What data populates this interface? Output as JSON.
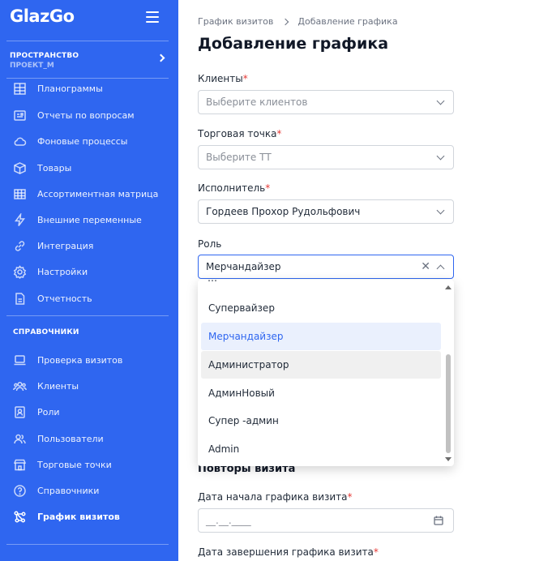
{
  "sidebar": {
    "logo": "GlazGo",
    "workspace": {
      "title": "ПРОСТРАНСТВО",
      "subtitle": "ПРОЕКТ_М"
    },
    "items": [
      {
        "label": "Планограммы",
        "icon": "planogram-icon"
      },
      {
        "label": "Отчеты по вопросам",
        "icon": "report-icon"
      },
      {
        "label": "Фоновые процессы",
        "icon": "cloud-icon"
      },
      {
        "label": "Товары",
        "icon": "box-icon"
      },
      {
        "label": "Ассортиментная матрица",
        "icon": "table-icon"
      },
      {
        "label": "Внешние переменные",
        "icon": "lightning-icon"
      },
      {
        "label": "Интеграция",
        "icon": "link-icon"
      },
      {
        "label": "Настройки",
        "icon": "gear-icon"
      },
      {
        "label": "Отчетность",
        "icon": "document-icon"
      }
    ],
    "section_title": "СПРАВОЧНИКИ",
    "ref_items": [
      {
        "label": "Проверка визитов",
        "icon": "laptop-icon"
      },
      {
        "label": "Клиенты",
        "icon": "users-icon"
      },
      {
        "label": "Роли",
        "icon": "id-card-icon"
      },
      {
        "label": "Пользователи",
        "icon": "user-group-icon"
      },
      {
        "label": "Торговые точки",
        "icon": "store-icon"
      },
      {
        "label": "Справочники",
        "icon": "book-icon"
      },
      {
        "label": "График визитов",
        "icon": "graph-icon",
        "active": true
      }
    ]
  },
  "breadcrumb": {
    "parent": "График визитов",
    "current": "Добавление графика"
  },
  "page_title": "Добавление графика",
  "form": {
    "clients": {
      "label": "Клиенты",
      "required": "*",
      "placeholder": "Выберите клиентов"
    },
    "outlet": {
      "label": "Торговая точка",
      "required": "*",
      "placeholder": "Выберите ТТ"
    },
    "executor": {
      "label": "Исполнитель",
      "required": "*",
      "value": "Гордеев Прохор Рудольфович"
    },
    "role": {
      "label": "Роль",
      "value": "Мерчандайзер",
      "options": [
        "Супервайзер",
        "Мерчандайзер",
        "Администратор",
        "АдминНовый",
        "Супер -админ",
        "Admin"
      ],
      "selected": "Мерчандайзер",
      "hovered": "Администратор"
    },
    "repeats_title": "Повторы визита",
    "start_date": {
      "label": "Дата начала графика визита",
      "required": "*",
      "placeholder": "__.__.____"
    },
    "end_date": {
      "label": "Дата завершения графика визита",
      "required": "*"
    }
  },
  "colors": {
    "sidebar": "#2f66f0",
    "accent": "#2f66f0",
    "required": "#e53935"
  }
}
